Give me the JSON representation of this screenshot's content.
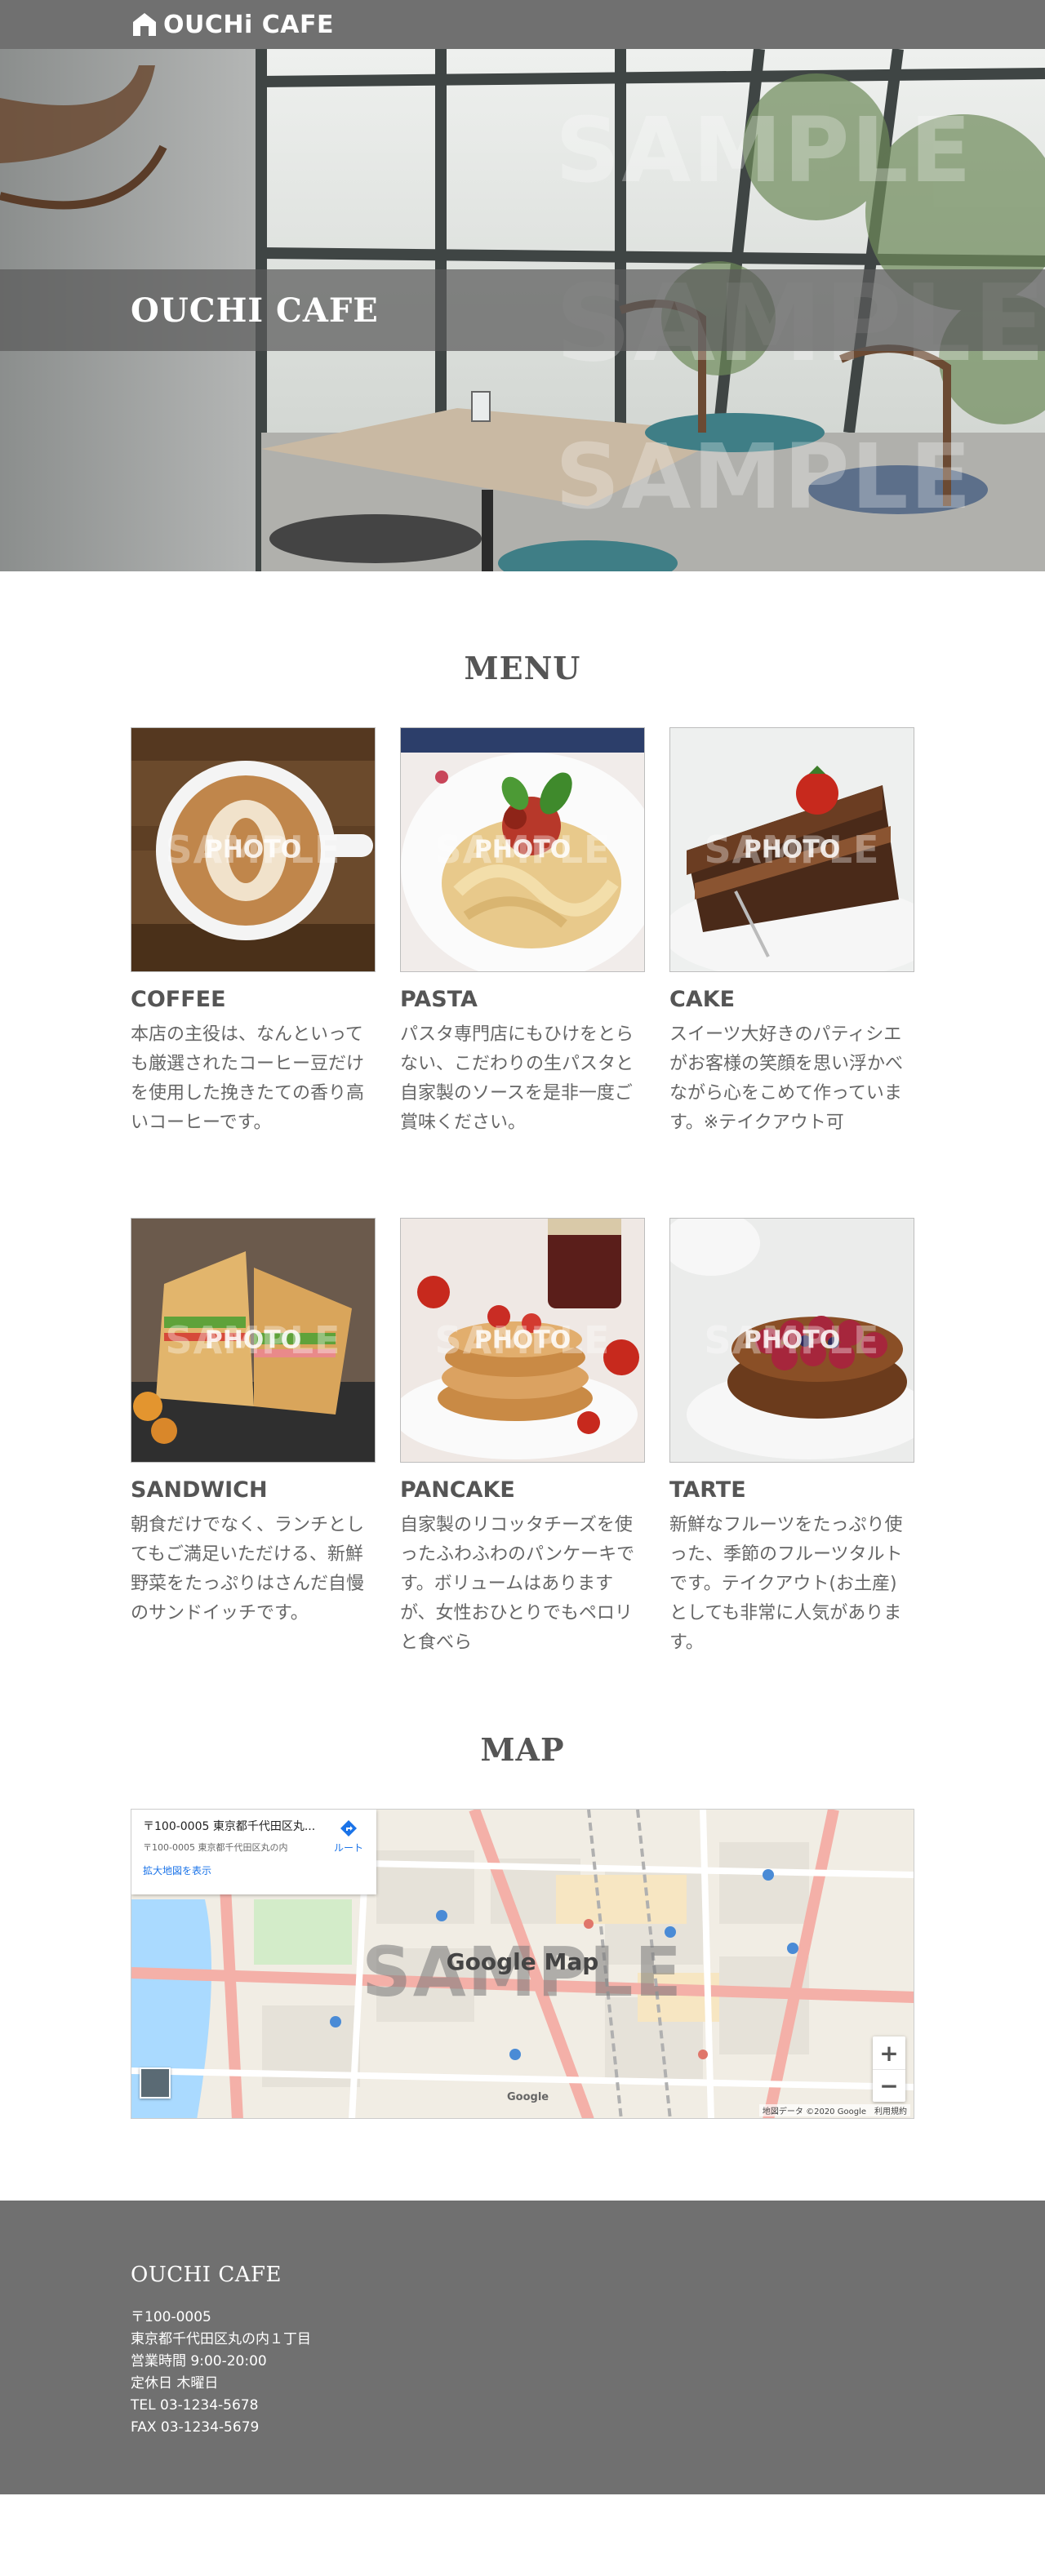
{
  "header": {
    "logo_text": "OUCHi CAFE"
  },
  "hero": {
    "title": "OUCHI CAFE",
    "watermark": "SAMPLE"
  },
  "menu": {
    "heading": "MENU",
    "photo_label": "PHOTO",
    "photo_watermark": "SAMPLE",
    "items": [
      {
        "name": "COFFEE",
        "description": "本店の主役は、なんといっても厳選されたコーヒー豆だけを使用した挽きたての香り高いコーヒーです。"
      },
      {
        "name": "PASTA",
        "description": "パスタ専門店にもひけをとらない、こだわりの生パスタと自家製のソースを是非一度ご賞味ください。"
      },
      {
        "name": "CAKE",
        "description": "スイーツ大好きのパティシエがお客様の笑顔を思い浮かべながら心をこめて作っています。※テイクアウト可"
      },
      {
        "name": "SANDWICH",
        "description": "朝食だけでなく、ランチとしてもご満足いただける、新鮮野菜をたっぷりはさんだ自慢のサンドイッチです。"
      },
      {
        "name": "PANCAKE",
        "description": "自家製のリコッタチーズを使ったふわふわのパンケーキです。ボリュームはありますが、女性おひとりでもペロリと食べら"
      },
      {
        "name": "TARTE",
        "description": "新鮮なフルーツをたっぷり使った、季節のフルーツタルトです。テイクアウト(お土産)としても非常に人気があります。"
      }
    ]
  },
  "map": {
    "heading": "MAP",
    "label": "Google Map",
    "watermark": "SAMPLE",
    "info_address": "〒100-0005 東京都千代田区丸...",
    "info_sub": "〒100-0005 東京都千代田区丸の内",
    "info_link": "拡大地図を表示",
    "route_label": "ルート",
    "zoom_in": "+",
    "zoom_out": "−",
    "google": "Google",
    "credit": "地図データ ©2020 Google　利用規約"
  },
  "footer": {
    "title": "OUCHI CAFE",
    "lines": [
      "〒100-0005",
      "東京都千代田区丸の内１丁目",
      "営業時間 9:00-20:00",
      "定休日 木曜日",
      "TEL 03-1234-5678",
      "FAX 03-1234-5679"
    ]
  },
  "colors": {
    "header_bg": "#707070",
    "footer_bg": "#707070",
    "text": "#555555"
  }
}
